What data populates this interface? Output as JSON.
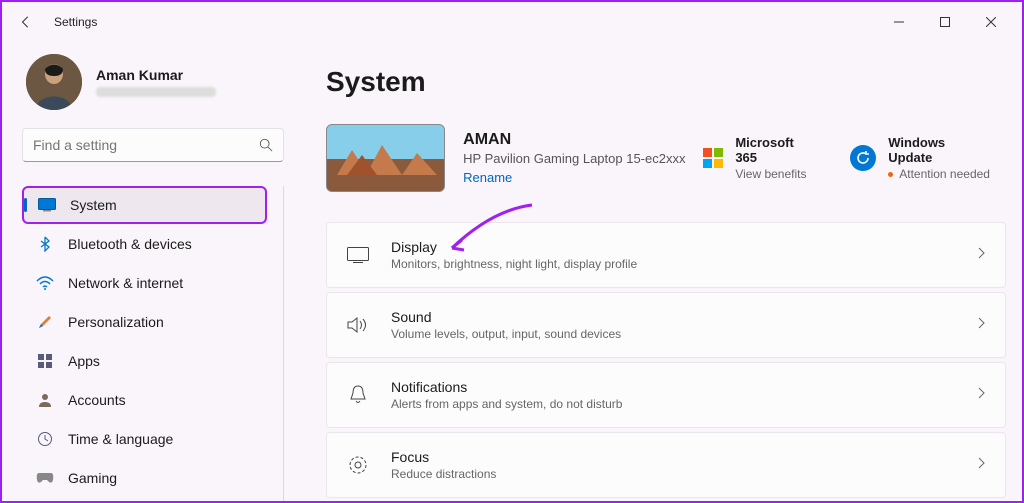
{
  "app_title": "Settings",
  "user": {
    "name": "Aman Kumar"
  },
  "search": {
    "placeholder": "Find a setting"
  },
  "nav": {
    "items": [
      {
        "label": "System",
        "active": true
      },
      {
        "label": "Bluetooth & devices"
      },
      {
        "label": "Network & internet"
      },
      {
        "label": "Personalization"
      },
      {
        "label": "Apps"
      },
      {
        "label": "Accounts"
      },
      {
        "label": "Time & language"
      },
      {
        "label": "Gaming"
      }
    ]
  },
  "main": {
    "title": "System",
    "device": {
      "name": "AMAN",
      "model": "HP Pavilion Gaming Laptop 15-ec2xxx",
      "rename": "Rename"
    },
    "tiles": {
      "ms365": {
        "title": "Microsoft 365",
        "sub": "View benefits"
      },
      "wu": {
        "title": "Windows Update",
        "sub": "Attention needed"
      }
    },
    "cards": [
      {
        "title": "Display",
        "sub": "Monitors, brightness, night light, display profile"
      },
      {
        "title": "Sound",
        "sub": "Volume levels, output, input, sound devices"
      },
      {
        "title": "Notifications",
        "sub": "Alerts from apps and system, do not disturb"
      },
      {
        "title": "Focus",
        "sub": "Reduce distractions"
      }
    ]
  }
}
